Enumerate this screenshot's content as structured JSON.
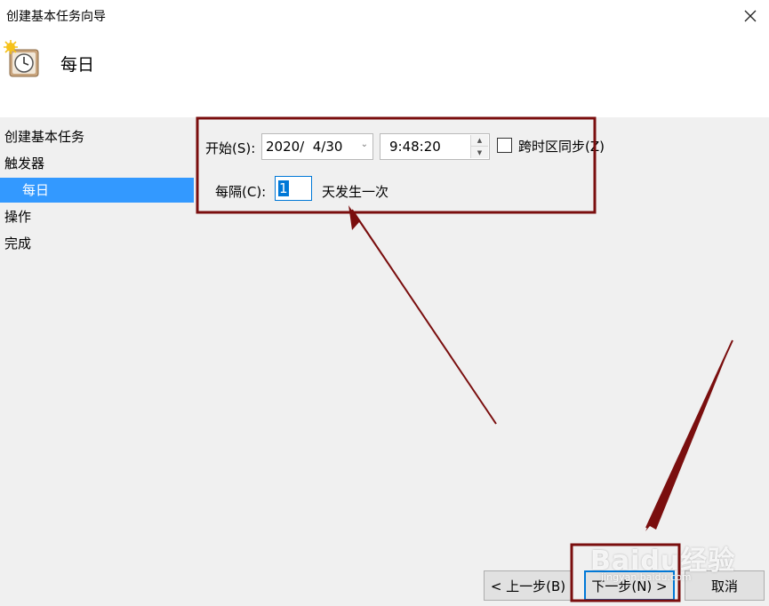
{
  "window": {
    "title": "创建基本任务向导",
    "close_icon": "close-icon"
  },
  "header": {
    "icon": "task-scheduler-clock-icon",
    "title": "每日"
  },
  "steps": [
    {
      "label": "创建基本任务",
      "active": false
    },
    {
      "label": "触发器",
      "active": false
    },
    {
      "label": "每日",
      "active": true
    },
    {
      "label": "操作",
      "active": false
    },
    {
      "label": "完成",
      "active": false
    }
  ],
  "form": {
    "start_label": "开始(S):",
    "start_date": "2020/  4/30",
    "start_time": "9:48:20",
    "sync_label": "跨时区同步(Z)",
    "sync_checked": false,
    "recur_label": "每隔(C):",
    "recur_value": "1",
    "recur_suffix": "天发生一次"
  },
  "buttons": {
    "back": "< 上一步(B)",
    "next": "下一步(N) >",
    "cancel": "取消"
  },
  "watermark": {
    "main": "Baidu经验",
    "sub": "jingyan.baidu.com"
  },
  "annotation_color": "#7a0e0e"
}
